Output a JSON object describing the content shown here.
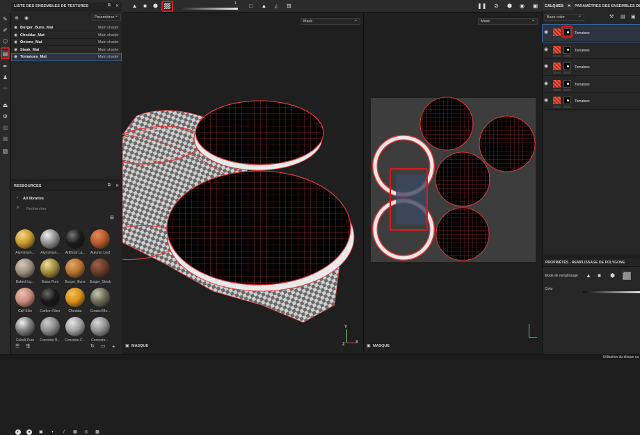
{
  "topbar": {
    "slider_value": "1",
    "icons": [
      "triangle-icon",
      "square-icon",
      "cube-icon",
      "checker-icon",
      "triangle-outline-icon",
      "uv-icon",
      "move-icon",
      "pause-icon",
      "camera-icon",
      "render-icon",
      "screenshot-icon"
    ]
  },
  "textureset_panel": {
    "title": "LISTE DES ENSEMBLES DE TEXTURES",
    "params_button": "Paramètres",
    "rows": [
      {
        "name": "Burger_Buns_Mat",
        "shader": "Main shader"
      },
      {
        "name": "Cheddar_Mat",
        "shader": "Main shader"
      },
      {
        "name": "Onions_Mat",
        "shader": "Main shader"
      },
      {
        "name": "Steak_Mat",
        "shader": "Main shader"
      },
      {
        "name": "Tomatoes_Mat",
        "shader": "Main shader"
      }
    ]
  },
  "resources": {
    "title": "RESSOURCES",
    "library": "All libraries",
    "search_placeholder": "Rechercher",
    "materials": [
      {
        "label": "Aluminium...",
        "color": "#c9982b",
        "hi": "#f4d88a"
      },
      {
        "label": "Aluminium...",
        "color": "#8e8e8e",
        "hi": "#f0f0f0"
      },
      {
        "label": "Artificial La...",
        "color": "#1a1a1a",
        "hi": "#777777"
      },
      {
        "label": "Autumn Leaf",
        "color": "#b5592b",
        "hi": "#e08a55"
      },
      {
        "label": "Baked Lig...",
        "color": "#9c8e7e",
        "hi": "#d6cbbd"
      },
      {
        "label": "Brass Pure",
        "color": "#a08a38",
        "hi": "#efe09a"
      },
      {
        "label": "Burger_Buns",
        "color": "#b8722e",
        "hi": "#e3a868"
      },
      {
        "label": "Burger_Steak",
        "color": "#6a3a28",
        "hi": "#a0614a"
      },
      {
        "label": "Calf Skin",
        "color": "#c88b7a",
        "hi": "#efc0b0"
      },
      {
        "label": "Carbon Fiber",
        "color": "#181818",
        "hi": "#6a6a6a"
      },
      {
        "label": "Cheddar",
        "color": "#d7901a",
        "hi": "#f4c15e"
      },
      {
        "label": "Coated Me...",
        "color": "#6a6a5a",
        "hi": "#c8c8b0"
      },
      {
        "label": "Cobalt Pure",
        "color": "#7a7a7a",
        "hi": "#f2f2f2"
      },
      {
        "label": "Concrete B...",
        "color": "#8a8a8a",
        "hi": "#cfcfcf"
      },
      {
        "label": "Concrete C...",
        "color": "#a0a0a0",
        "hi": "#e6e6e6"
      },
      {
        "label": "Concrete ...",
        "color": "#909090",
        "hi": "#d8d8d8"
      }
    ]
  },
  "viewport3d": {
    "mode_dropdown": "Mask",
    "footer": "MASQUE",
    "axes": {
      "y": "Y",
      "x": "X",
      "z": "Z"
    }
  },
  "viewport2d": {
    "mode_dropdown": "Mask",
    "footer": "MASQUE"
  },
  "layers_panel": {
    "tab_active": "CALQUES",
    "tab_other": "PARAMÈTRES DES ENSEMBLES DE",
    "channel_dropdown": "Base color",
    "layers": [
      {
        "name": "Tomatoes"
      },
      {
        "name": "Tomatoes"
      },
      {
        "name": "Tomatoes"
      },
      {
        "name": "Tomatoes"
      },
      {
        "name": "Tomatoes"
      }
    ]
  },
  "properties": {
    "title": "PROPRIÉTÉS - REMPLISSAGE DE POLYGONE",
    "fill_mode_label": "Mode de remplissage",
    "color_label": "Color"
  },
  "statusbar": {
    "text": "Utilisation du disque ca"
  },
  "colors": {
    "highlight": "#d41c1c",
    "selection": "#3d6aa8",
    "wireframe": "#e2383a"
  }
}
